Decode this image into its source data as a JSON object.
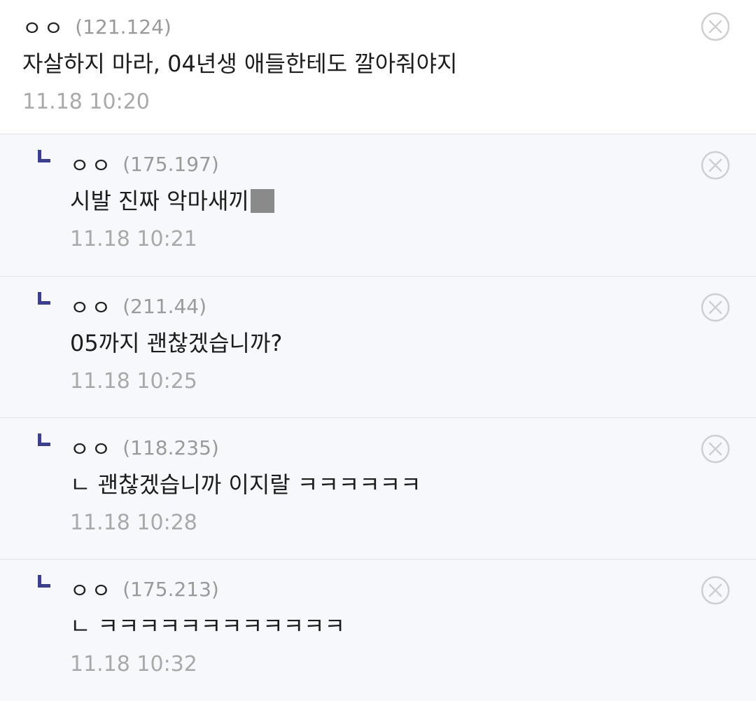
{
  "comments": [
    {
      "nick": "ㅇㅇ",
      "ip": "(121.124)",
      "text": "자살하지 마라, 04년생 애들한테도 깔아줘야지",
      "time": "11.18 10:20"
    },
    {
      "nick": "ㅇㅇ",
      "ip": "(175.197)",
      "text": "시발 진짜 악마새끼",
      "time": "11.18 10:21"
    },
    {
      "nick": "ㅇㅇ",
      "ip": "(211.44)",
      "text": "05까지 괜찮겠습니까?",
      "time": "11.18 10:25"
    },
    {
      "nick": "ㅇㅇ",
      "ip": "(118.235)",
      "text": "ㄴ 괜찮겠습니까 이지랄 ㅋㅋㅋㅋㅋㅋ",
      "time": "11.18 10:28"
    },
    {
      "nick": "ㅇㅇ",
      "ip": "(175.213)",
      "text": "ㄴ ㅋㅋㅋㅋㅋㅋㅋㅋㅋㅋㅋㅋ",
      "time": "11.18 10:32"
    }
  ],
  "icons": {
    "reply": "reply-arrow-icon",
    "delete": "delete-circle-x-icon",
    "censor": "censor-block"
  },
  "colors": {
    "reply_mark": "#3b3f8c",
    "reply_bg": "#f7f8fb",
    "meta_gray": "#9a9a9a"
  }
}
